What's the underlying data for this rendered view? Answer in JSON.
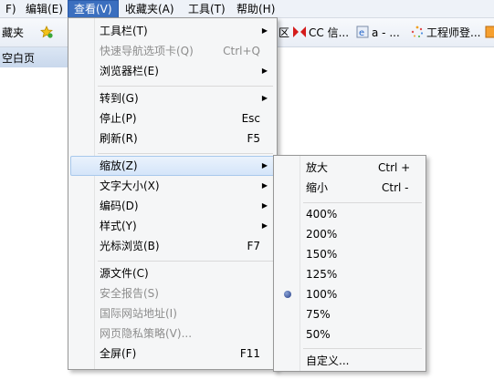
{
  "menubar": {
    "items": [
      "F)",
      "编辑(E)",
      "查看(V)",
      "收藏夹(A)",
      "工具(T)",
      "帮助(H)"
    ]
  },
  "favorites": {
    "left_label": "藏夹",
    "items": [
      "区",
      "CC 信...",
      "a - ...",
      "工程师登..."
    ]
  },
  "tab": {
    "label": "空白页"
  },
  "view_menu": {
    "items": [
      {
        "label": "工具栏(T)",
        "shortcut": "",
        "submenu": true,
        "disabled": false
      },
      {
        "label": "快速导航选项卡(Q)",
        "shortcut": "Ctrl+Q",
        "submenu": false,
        "disabled": true
      },
      {
        "label": "浏览器栏(E)",
        "shortcut": "",
        "submenu": true,
        "disabled": false
      },
      {
        "label": "转到(G)",
        "shortcut": "",
        "submenu": true,
        "disabled": false
      },
      {
        "label": "停止(P)",
        "shortcut": "Esc",
        "submenu": false,
        "disabled": false
      },
      {
        "label": "刷新(R)",
        "shortcut": "F5",
        "submenu": false,
        "disabled": false
      },
      {
        "label": "缩放(Z)",
        "shortcut": "",
        "submenu": true,
        "disabled": false
      },
      {
        "label": "文字大小(X)",
        "shortcut": "",
        "submenu": true,
        "disabled": false
      },
      {
        "label": "编码(D)",
        "shortcut": "",
        "submenu": true,
        "disabled": false
      },
      {
        "label": "样式(Y)",
        "shortcut": "",
        "submenu": true,
        "disabled": false
      },
      {
        "label": "光标浏览(B)",
        "shortcut": "F7",
        "submenu": false,
        "disabled": false
      },
      {
        "label": "源文件(C)",
        "shortcut": "",
        "submenu": false,
        "disabled": false
      },
      {
        "label": "安全报告(S)",
        "shortcut": "",
        "submenu": false,
        "disabled": true
      },
      {
        "label": "国际网站地址(I)",
        "shortcut": "",
        "submenu": false,
        "disabled": true
      },
      {
        "label": "网页隐私策略(V)...",
        "shortcut": "",
        "submenu": false,
        "disabled": true
      },
      {
        "label": "全屏(F)",
        "shortcut": "F11",
        "submenu": false,
        "disabled": false
      }
    ]
  },
  "zoom_menu": {
    "zoom_in": {
      "label": "放大",
      "shortcut": "Ctrl +"
    },
    "zoom_out": {
      "label": "缩小",
      "shortcut": "Ctrl -"
    },
    "levels": [
      "400%",
      "200%",
      "150%",
      "125%",
      "100%",
      "75%",
      "50%"
    ],
    "selected_level": "100%",
    "custom": "自定义..."
  },
  "colors": {
    "menubar_active": "#3b6fbf",
    "highlight_border": "#a8c8ec"
  }
}
